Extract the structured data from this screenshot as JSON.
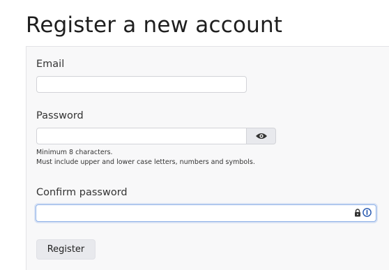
{
  "page": {
    "title": "Register a new account"
  },
  "form": {
    "email": {
      "label": "Email",
      "value": ""
    },
    "password": {
      "label": "Password",
      "value": "",
      "toggle_icon": "eye-icon",
      "help_lines": [
        "Minimum 8 characters.",
        "Must include upper and lower case letters, numbers and symbols."
      ]
    },
    "confirm_password": {
      "label": "Confirm password",
      "value": "",
      "focused": true,
      "icons": [
        "lock-icon",
        "password-manager-icon"
      ]
    },
    "submit_label": "Register"
  },
  "colors": {
    "focus_border": "#8fb2e8",
    "card_background": "#f8f8f9",
    "addon_background": "#e8e9ed",
    "password_manager_blue": "#2f5fb3"
  }
}
